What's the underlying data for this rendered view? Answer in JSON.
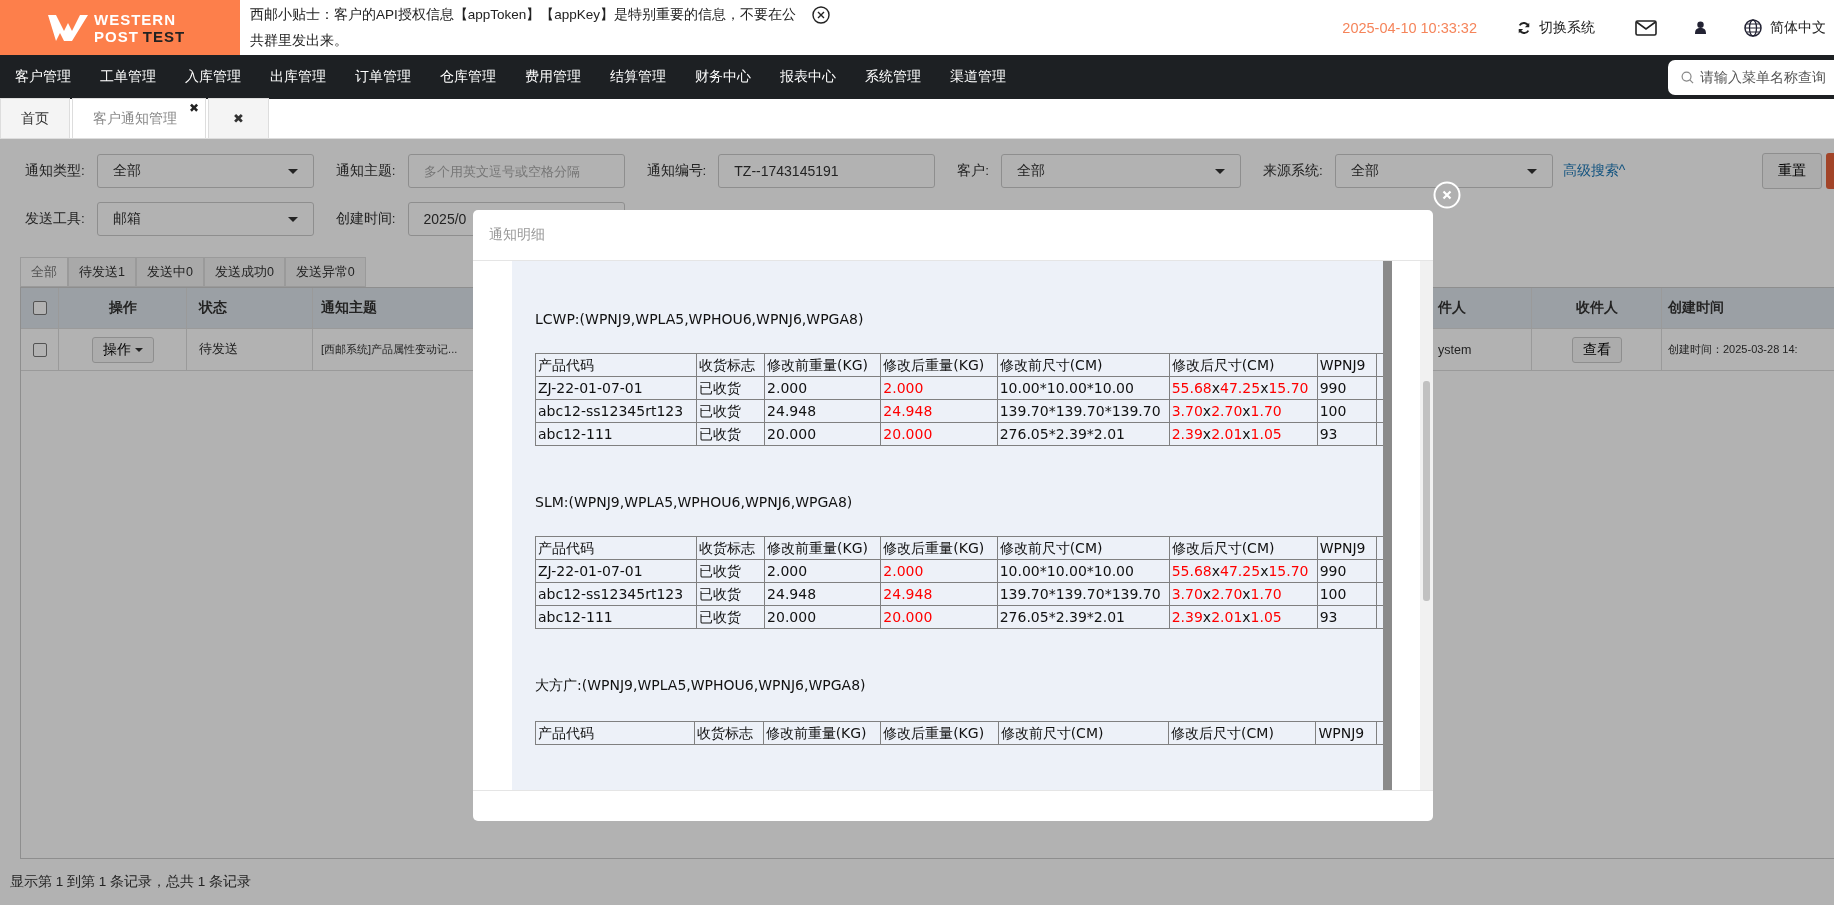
{
  "logo": {
    "line_1": "WESTERN",
    "line_2": "POST",
    "line_3": "TEST"
  },
  "tip": "西邮小贴士：客户的API授权信息【appToken】【appKey】是特别重要的信息，不要在公共群里发出来。",
  "datetime": "2025-04-10 10:33:32",
  "switch_system": "切换系统",
  "language": "简体中文",
  "nav": [
    "客户管理",
    "工单管理",
    "入库管理",
    "出库管理",
    "订单管理",
    "仓库管理",
    "费用管理",
    "结算管理",
    "财务中心",
    "报表中心",
    "系统管理",
    "渠道管理"
  ],
  "menu_search": {
    "placeholder": "请输入菜单名称查询"
  },
  "page_tabs": [
    {
      "label": "首页",
      "selected": false,
      "closable": false
    },
    {
      "label": "客户通知管理",
      "selected": true,
      "closable": true
    }
  ],
  "close_all": "✖",
  "filters": [
    {
      "label": "通知类型:",
      "kind": "select",
      "value": "全部"
    },
    {
      "label": "通知主题:",
      "kind": "input",
      "placeholder": "多个用英文逗号或空格分隔"
    },
    {
      "label": "通知编号:",
      "kind": "input",
      "value": "TZ--1743145191"
    },
    {
      "label": "客户:",
      "kind": "select",
      "value": "全部"
    },
    {
      "label": "来源系统:",
      "kind": "select",
      "value": "全部"
    }
  ],
  "filters_row_2": [
    {
      "label": "发送工具:",
      "kind": "select",
      "value": "邮箱"
    },
    {
      "label": "创建时间:",
      "kind": "input",
      "value": "2025/0"
    }
  ],
  "advanced_search": "高级搜索^",
  "reset": "重置",
  "status_tabs": [
    {
      "label": "全部",
      "selected": true
    },
    {
      "label": "待发送1",
      "selected": false
    },
    {
      "label": "发送中0",
      "selected": false
    },
    {
      "label": "发送成功0",
      "selected": false
    },
    {
      "label": "发送异常0",
      "selected": false
    }
  ],
  "table": {
    "select_all": {
      "checked": false
    },
    "columns": [
      "操作",
      "状态",
      "通知主题",
      "件人",
      "收件人",
      "创建时间"
    ],
    "rows": [
      {
        "checked": false,
        "action": "操作",
        "status": "待发送",
        "subject": "[西邮系统]产品属性变动记...",
        "sender": "ystem",
        "receiver": "查看",
        "created": "创建时间：2025-03-28 14:"
      }
    ]
  },
  "footer": "显示第 1 到第 1 条记录，总共 1 条记录",
  "modal": {
    "title": "通知明细",
    "sections": [
      {
        "heading": "LCWP:(WPNJ9,WPLA5,WPHOU6,WPNJ6,WPGA8)",
        "columns": [
          "产品代码",
          "收货标志",
          "修改前重量(KG)",
          "修改后重量(KG)",
          "修改前尺寸(CM)",
          "修改后尺寸(CM)",
          "WPNJ9"
        ],
        "rows": [
          {
            "code": "ZJ-22-01-07-01",
            "received": "已收货",
            "before_weight": "2.000",
            "after_weight": {
              "text": "2.000",
              "changed": true
            },
            "before_size": "10.00*10.00*10.00",
            "after_size": [
              {
                "text": "55.68",
                "changed": true
              },
              {
                "text": "x",
                "changed": false
              },
              {
                "text": "47.25",
                "changed": true
              },
              {
                "text": "x",
                "changed": false
              },
              {
                "text": "15.70",
                "changed": true
              }
            ],
            "wpnj9": "990"
          },
          {
            "code": "abc12-ss12345rt123",
            "received": "已收货",
            "before_weight": "24.948",
            "after_weight": {
              "text": "24.948",
              "changed": true
            },
            "before_size": "139.70*139.70*139.70",
            "after_size": [
              {
                "text": "3.70",
                "changed": true
              },
              {
                "text": "x",
                "changed": false
              },
              {
                "text": "2.70",
                "changed": true
              },
              {
                "text": "x",
                "changed": false
              },
              {
                "text": "1.70",
                "changed": true
              }
            ],
            "wpnj9": "100"
          },
          {
            "code": "abc12-111",
            "received": "已收货",
            "before_weight": "20.000",
            "after_weight": {
              "text": "20.000",
              "changed": true
            },
            "before_size": "276.05*2.39*2.01",
            "after_size": [
              {
                "text": "2.39",
                "changed": true
              },
              {
                "text": "x",
                "changed": false
              },
              {
                "text": "2.01",
                "changed": true
              },
              {
                "text": "x",
                "changed": false
              },
              {
                "text": "1.05",
                "changed": true
              }
            ],
            "wpnj9": "93"
          }
        ]
      },
      {
        "heading": "SLM:(WPNJ9,WPLA5,WPHOU6,WPNJ6,WPGA8)",
        "columns": [
          "产品代码",
          "收货标志",
          "修改前重量(KG)",
          "修改后重量(KG)",
          "修改前尺寸(CM)",
          "修改后尺寸(CM)",
          "WPNJ9"
        ],
        "rows": [
          {
            "code": "ZJ-22-01-07-01",
            "received": "已收货",
            "before_weight": "2.000",
            "after_weight": {
              "text": "2.000",
              "changed": true
            },
            "before_size": "10.00*10.00*10.00",
            "after_size": [
              {
                "text": "55.68",
                "changed": true
              },
              {
                "text": "x",
                "changed": false
              },
              {
                "text": "47.25",
                "changed": true
              },
              {
                "text": "x",
                "changed": false
              },
              {
                "text": "15.70",
                "changed": true
              }
            ],
            "wpnj9": "990"
          },
          {
            "code": "abc12-ss12345rt123",
            "received": "已收货",
            "before_weight": "24.948",
            "after_weight": {
              "text": "24.948",
              "changed": true
            },
            "before_size": "139.70*139.70*139.70",
            "after_size": [
              {
                "text": "3.70",
                "changed": true
              },
              {
                "text": "x",
                "changed": false
              },
              {
                "text": "2.70",
                "changed": true
              },
              {
                "text": "x",
                "changed": false
              },
              {
                "text": "1.70",
                "changed": true
              }
            ],
            "wpnj9": "100"
          },
          {
            "code": "abc12-111",
            "received": "已收货",
            "before_weight": "20.000",
            "after_weight": {
              "text": "20.000",
              "changed": true
            },
            "before_size": "276.05*2.39*2.01",
            "after_size": [
              {
                "text": "2.39",
                "changed": true
              },
              {
                "text": "x",
                "changed": false
              },
              {
                "text": "2.01",
                "changed": true
              },
              {
                "text": "x",
                "changed": false
              },
              {
                "text": "1.05",
                "changed": true
              }
            ],
            "wpnj9": "93"
          }
        ]
      },
      {
        "heading": "大方广:(WPNJ9,WPLA5,WPHOU6,WPNJ6,WPGA8)",
        "columns": [
          "产品代码",
          "收货标志",
          "修改前重量(KG)",
          "修改后重量(KG)",
          "修改前尺寸(CM)",
          "修改后尺寸(CM)",
          "WPNJ9"
        ]
      }
    ]
  }
}
